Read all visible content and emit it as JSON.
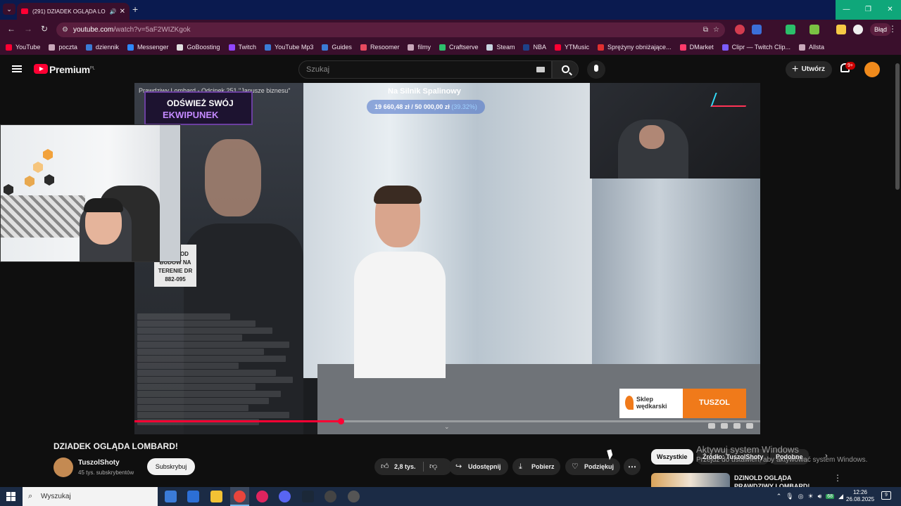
{
  "browser": {
    "tab_title": "(291) DZIADEK OGLĄDA LO",
    "url_host": "youtube.com",
    "url_path": "/watch?v=5aF2WIZKgok",
    "profile_status": "Błąd"
  },
  "bookmarks": [
    {
      "label": "YouTube",
      "color": "#ff0033"
    },
    {
      "label": "poczta",
      "color": "#c9a8ba"
    },
    {
      "label": "dziennik",
      "color": "#3a7bd5"
    },
    {
      "label": "Messenger",
      "color": "#2d88ff"
    },
    {
      "label": "GoBoosting",
      "color": "#e0e0e0"
    },
    {
      "label": "Twitch",
      "color": "#9146ff"
    },
    {
      "label": "YouTube Mp3",
      "color": "#3a7bd5"
    },
    {
      "label": "Guides",
      "color": "#3a7bd5"
    },
    {
      "label": "Resoomer",
      "color": "#e84a5f"
    },
    {
      "label": "filmy",
      "color": "#c9a8ba"
    },
    {
      "label": "Craftserve",
      "color": "#2dbf6c"
    },
    {
      "label": "Steam",
      "color": "#c7d5e0"
    },
    {
      "label": "NBA",
      "color": "#1d428a"
    },
    {
      "label": "YTMusic",
      "color": "#ff0033"
    },
    {
      "label": "Sprężyny obniżające...",
      "color": "#e03030"
    },
    {
      "label": "DMarket",
      "color": "#ff3b6b"
    },
    {
      "label": "Clipr — Twitch Clip...",
      "color": "#7b5cff"
    },
    {
      "label": "Allsta",
      "color": "#c9a8ba"
    }
  ],
  "youtube": {
    "brand": "Premium",
    "region": "PL",
    "search_placeholder": "Szukaj",
    "create_label": "Utwórz",
    "notifications": "9+"
  },
  "video": {
    "overlay_title": "Prawdziwy Lombard - Odcinek 251 \"Janusze biznesu\"",
    "banner_line1": "ODŚWIEŻ SWÓJ",
    "banner_line2": "EKWIPUNEK",
    "goal_label": "Na Silnik Spalinowy",
    "goal_current": "19 660,48 zł",
    "goal_target": "50 000,00 zł",
    "goal_pct": "(39.32%)",
    "sign_text": "DZIA POD BUDOW NA TERENIE DR 882-095",
    "sponsor_name": "Sklep wędkarski",
    "sponsor_code": "TUSZOL",
    "progress": 0.33
  },
  "info": {
    "title": "DZIADEK OGLĄDA LOMBARD!",
    "channel": "TuszolShoty",
    "subscribers": "45 tys. subskrybentów",
    "subscribe": "Subskrybuj",
    "likes": "2,8 tys.",
    "share": "Udostępnij",
    "download": "Pobierz",
    "thanks": "Podziękuj"
  },
  "sidebar": {
    "chips": [
      "Wszystkie",
      "Źródło: TuszolShoty",
      "Podobne"
    ],
    "activate_line1": "Aktywuj system Windows",
    "activate_line2": "Przejdź do ustawień, aby aktywować system Windows.",
    "rec_title": "DZINOLD OGLĄDA PRAWDZIWY LOMBARD!"
  },
  "taskbar": {
    "search_placeholder": "Wyszukaj",
    "battery": "68",
    "time": "12:26",
    "date": "26.08.2025",
    "notification_count": "9"
  }
}
